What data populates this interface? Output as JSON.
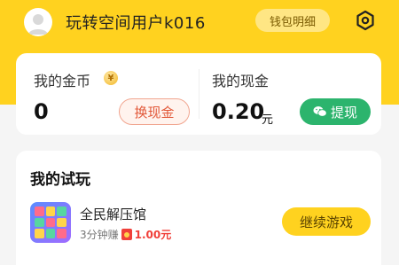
{
  "header": {
    "username": "玩转空间用户k016",
    "wallet_detail_label": "钱包明细"
  },
  "money": {
    "coins_label": "我的金币",
    "coin_icon_symbol": "¥",
    "coins_value": "0",
    "exchange_label": "换现金",
    "cash_label": "我的现金",
    "cash_value": "0.20",
    "cash_unit": "元",
    "withdraw_label": "提现"
  },
  "trial": {
    "title": "我的试玩",
    "games": [
      {
        "name": "全民解压馆",
        "desc_prefix": "3分钟赚",
        "reward": "1.00元",
        "action_label": "继续游戏"
      }
    ]
  },
  "colors": {
    "brand_yellow": "#ffd21f",
    "withdraw_green": "#2cb46d",
    "exchange_red": "#e2593a"
  }
}
